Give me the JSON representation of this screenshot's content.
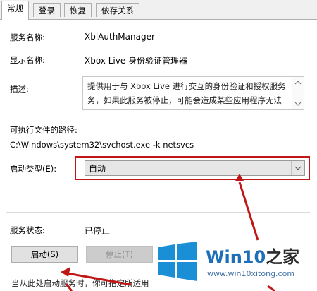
{
  "tabs": [
    {
      "label": "常规"
    },
    {
      "label": "登录"
    },
    {
      "label": "恢复"
    },
    {
      "label": "依存关系"
    }
  ],
  "fields": {
    "service_name_label": "服务名称:",
    "service_name_value": "XblAuthManager",
    "display_name_label": "显示名称:",
    "display_name_value": "Xbox Live 身份验证管理器",
    "description_label": "描述:",
    "description_line1": "提供用于与 Xbox Live 进行交互的身份验证和授权服务",
    "description_line2": "务，如果此服务被停止，可能会造成某些应用程序无法",
    "exe_path_label": "可执行文件的路径:",
    "exe_path_value": "C:\\Windows\\system32\\svchost.exe -k netsvcs",
    "startup_type_label": "启动类型(E):",
    "startup_type_value": "自动"
  },
  "status": {
    "label": "服务状态:",
    "value": "已停止"
  },
  "buttons": {
    "start": "启动(S)",
    "stop": "停止(T)"
  },
  "footer_text": "当从此处启动服务时，你可指定所适用",
  "watermark": {
    "brand": "Win10",
    "brand_suffix": "之家",
    "url": "www.win10xitong.com"
  },
  "colors": {
    "annotation": "#c01616",
    "brand_blue": "#1e6fb8"
  }
}
